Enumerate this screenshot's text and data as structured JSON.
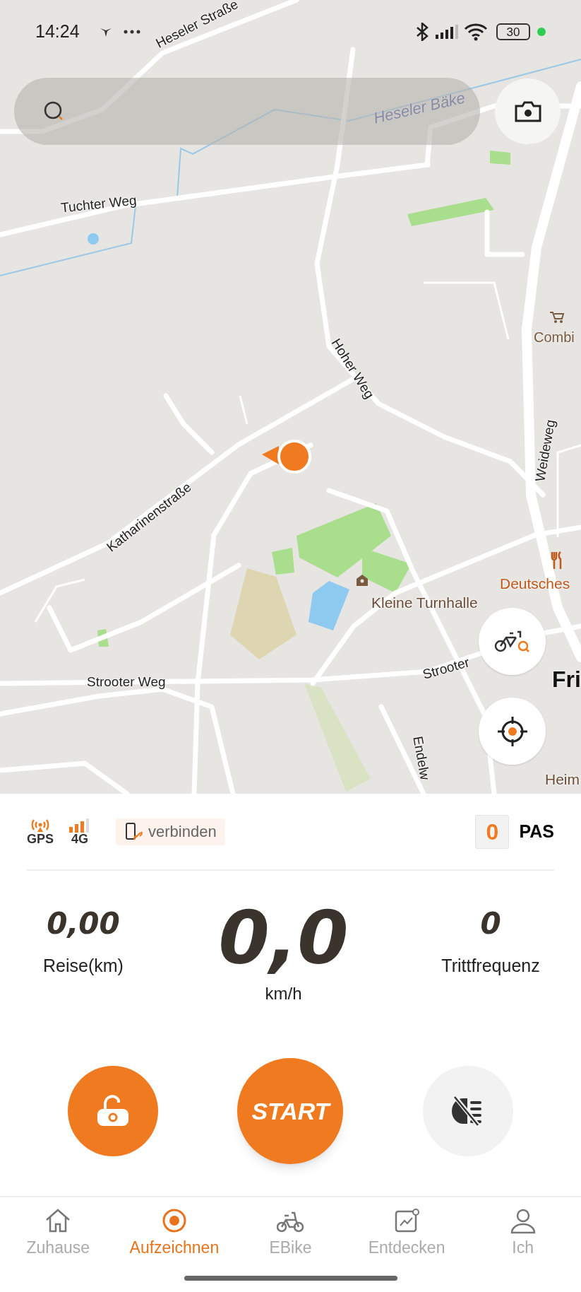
{
  "status_bar": {
    "time": "14:24",
    "battery": "30"
  },
  "map_labels": [
    {
      "text": "Heseler Straße",
      "kind": "street"
    },
    {
      "text": "Heseler Bäke",
      "kind": "water"
    },
    {
      "text": "Tuchter Weg",
      "kind": "street"
    },
    {
      "text": "Hoher Weg",
      "kind": "street"
    },
    {
      "text": "Combi",
      "kind": "shop"
    },
    {
      "text": "Weideweg",
      "kind": "street"
    },
    {
      "text": "Katharinenstraße",
      "kind": "street"
    },
    {
      "text": "Kleine Turnhalle",
      "kind": "place"
    },
    {
      "text": "Deutsches",
      "kind": "food"
    },
    {
      "text": "Strooter Weg",
      "kind": "street"
    },
    {
      "text": "Strooter",
      "kind": "street"
    },
    {
      "text": "Fri",
      "kind": "town"
    },
    {
      "text": "Endelw",
      "kind": "street"
    },
    {
      "text": "Heim",
      "kind": "place"
    }
  ],
  "panel": {
    "gps_label": "GPS",
    "network_label": "4G",
    "connect_button": "verbinden",
    "pas_level": "0",
    "pas_label": "PAS",
    "stats": [
      {
        "value": "0,00",
        "label": "Reise(km)",
        "kind": "side"
      },
      {
        "value": "0,0",
        "label": "km/h",
        "kind": "main"
      },
      {
        "value": "0",
        "label": "Trittfrequenz",
        "kind": "side"
      }
    ],
    "start_button": "START",
    "headlight_on": false
  },
  "nav": [
    {
      "label": "Zuhause",
      "kind": "home",
      "selected": false
    },
    {
      "label": "Aufzeichnen",
      "kind": "record",
      "selected": true
    },
    {
      "label": "EBike",
      "kind": "bike",
      "selected": false
    },
    {
      "label": "Entdecken",
      "kind": "discover",
      "selected": false
    },
    {
      "label": "Ich",
      "kind": "profile",
      "selected": false
    }
  ]
}
